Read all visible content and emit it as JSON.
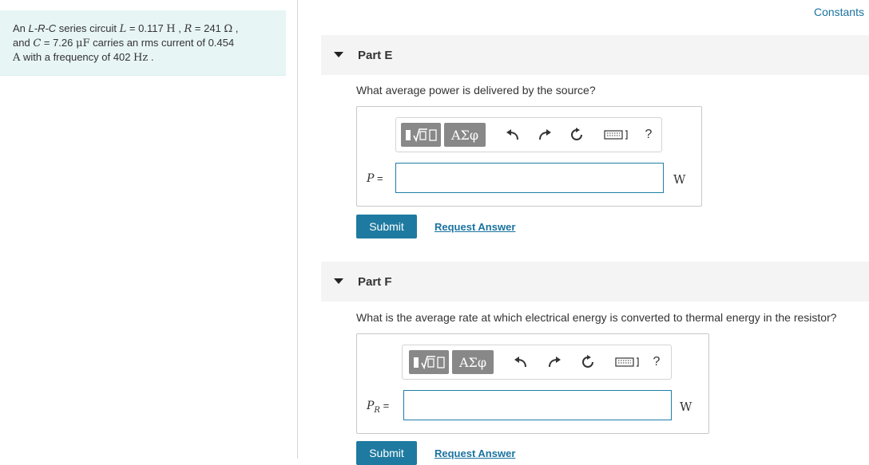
{
  "problem": {
    "prefix": "An ",
    "circuit_type": "L-R-C",
    "text1": " series circuit ",
    "L_sym": "L",
    "L_val": " = 0.117 ",
    "L_unit": "H",
    "sep1": " , ",
    "R_sym": "R",
    "R_val": " = 241 ",
    "R_unit": "Ω",
    "sep2": " ,",
    "line2_a": "and ",
    "C_sym": "C",
    "C_val": " = 7.26 ",
    "C_unit": "μF",
    "line2_b": " carries an rms current of 0.454",
    "line3_unit": "A",
    "line3_text": " with a frequency of 402 ",
    "f_unit": "Hz",
    "line3_end": " ."
  },
  "constants_link": "Constants",
  "toolbar": {
    "template_button": "▮√▯",
    "greek_button": "ΑΣφ",
    "undo_icon": "undo-icon",
    "redo_icon": "redo-icon",
    "reset_icon": "reset-icon",
    "keyboard_icon": "keyboard-icon",
    "help_label": "?"
  },
  "partE": {
    "title": "Part E",
    "question": "What average power is delivered by the source?",
    "var": "P",
    "equals": " =",
    "input_value": "",
    "unit": "W",
    "submit": "Submit",
    "request": "Request Answer"
  },
  "partF": {
    "title": "Part F",
    "question": "What is the average rate at which electrical energy is converted to thermal energy in the resistor?",
    "var": "P",
    "sub": "R",
    "equals": " =",
    "input_value": "",
    "unit": "W",
    "submit": "Submit",
    "request": "Request Answer"
  },
  "colors": {
    "accent": "#1e7aa0",
    "problem_bg": "#e8f5f5",
    "header_bg": "#f4f4f4",
    "toolbar_btn": "#888888"
  }
}
